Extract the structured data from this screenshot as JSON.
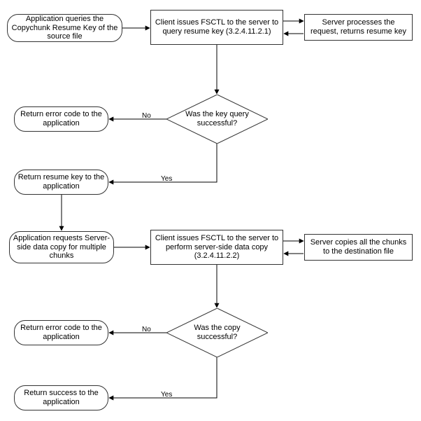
{
  "nodes": {
    "app_query_key": "Application queries the Copychunk Resume Key of the source file",
    "client_query": "Client issues FSCTL to the server to query resume key (3.2.4.11.2.1)",
    "server_query": "Server processes the request, returns resume key",
    "decision_key": "Was the key query successful?",
    "err_key": "Return error code to the application",
    "ok_key": "Return resume key to the application",
    "app_copy_req": "Application requests Server-side data copy for multiple chunks",
    "client_copy": "Client issues FSCTL to the server to perform server-side data copy (3.2.4.11.2.2)",
    "server_copy": "Server copies all the chunks to the destination file",
    "decision_copy": "Was the copy successful?",
    "err_copy": "Return error code to the application",
    "ok_copy": "Return success to the application"
  },
  "labels": {
    "yes": "Yes",
    "no": "No"
  },
  "chart_data": {
    "type": "flowchart",
    "nodes": [
      {
        "id": "app_query_key",
        "shape": "terminator"
      },
      {
        "id": "client_query",
        "shape": "process"
      },
      {
        "id": "server_query",
        "shape": "process"
      },
      {
        "id": "decision_key",
        "shape": "decision"
      },
      {
        "id": "err_key",
        "shape": "terminator"
      },
      {
        "id": "ok_key",
        "shape": "terminator"
      },
      {
        "id": "app_copy_req",
        "shape": "terminator"
      },
      {
        "id": "client_copy",
        "shape": "process"
      },
      {
        "id": "server_copy",
        "shape": "process"
      },
      {
        "id": "decision_copy",
        "shape": "decision"
      },
      {
        "id": "err_copy",
        "shape": "terminator"
      },
      {
        "id": "ok_copy",
        "shape": "terminator"
      }
    ],
    "edges": [
      {
        "from": "app_query_key",
        "to": "client_query"
      },
      {
        "from": "client_query",
        "to": "server_query",
        "bidirectional": true
      },
      {
        "from": "client_query",
        "to": "decision_key"
      },
      {
        "from": "decision_key",
        "to": "err_key",
        "label": "No"
      },
      {
        "from": "decision_key",
        "to": "ok_key",
        "label": "Yes"
      },
      {
        "from": "ok_key",
        "to": "app_copy_req"
      },
      {
        "from": "app_copy_req",
        "to": "client_copy"
      },
      {
        "from": "client_copy",
        "to": "server_copy",
        "bidirectional": true
      },
      {
        "from": "client_copy",
        "to": "decision_copy"
      },
      {
        "from": "decision_copy",
        "to": "err_copy",
        "label": "No"
      },
      {
        "from": "decision_copy",
        "to": "ok_copy",
        "label": "Yes"
      }
    ]
  }
}
